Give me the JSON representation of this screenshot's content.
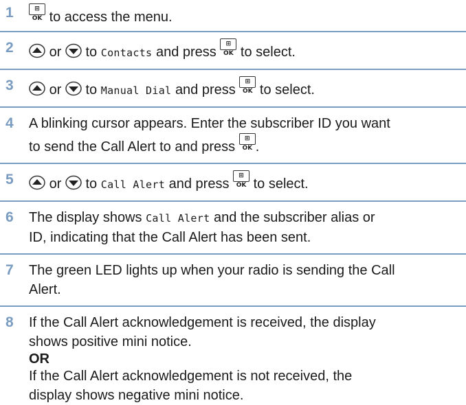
{
  "steps": [
    {
      "num": "1",
      "ok": "⊞ OK",
      "text": "to access the menu."
    },
    {
      "num": "2",
      "or": "or",
      "to": "to",
      "item": "Contacts",
      "press": "and press",
      "ok": "⊞ OK",
      "end": "to select."
    },
    {
      "num": "3",
      "or": "or",
      "to": "to",
      "item": "Manual Dial",
      "press": "and press",
      "ok": "⊞ OK",
      "end": "to select."
    },
    {
      "num": "4",
      "line1": "A blinking cursor appears. Enter the subscriber ID you want",
      "line2": "to send the Call Alert to and press",
      "ok": "⊞ OK",
      "end": "."
    },
    {
      "num": "5",
      "or": "or",
      "to": "to",
      "item": "Call Alert",
      "press": "and press",
      "ok": "⊞ OK",
      "end": "to select."
    },
    {
      "num": "6",
      "pre": "The display shows",
      "item": "Call Alert",
      "post": "and the subscriber alias or",
      "line2": "ID, indicating that the Call Alert has been sent."
    },
    {
      "num": "7",
      "line1": "The green LED lights up when your radio is sending the Call",
      "line2": "Alert."
    },
    {
      "num": "8",
      "line1": "If the Call Alert acknowledgement is received, the display",
      "line2": "shows positive mini notice.",
      "or_label": "OR",
      "line3": "If the Call Alert acknowledgement is not received, the",
      "line4": "display shows negative mini notice."
    }
  ],
  "icons": {
    "up": "up-arrow-key-icon",
    "down": "down-arrow-key-icon",
    "ok": "menu-ok-key-icon"
  },
  "colors": {
    "accent": "#7a9cc0",
    "text": "#1a1a1a"
  }
}
